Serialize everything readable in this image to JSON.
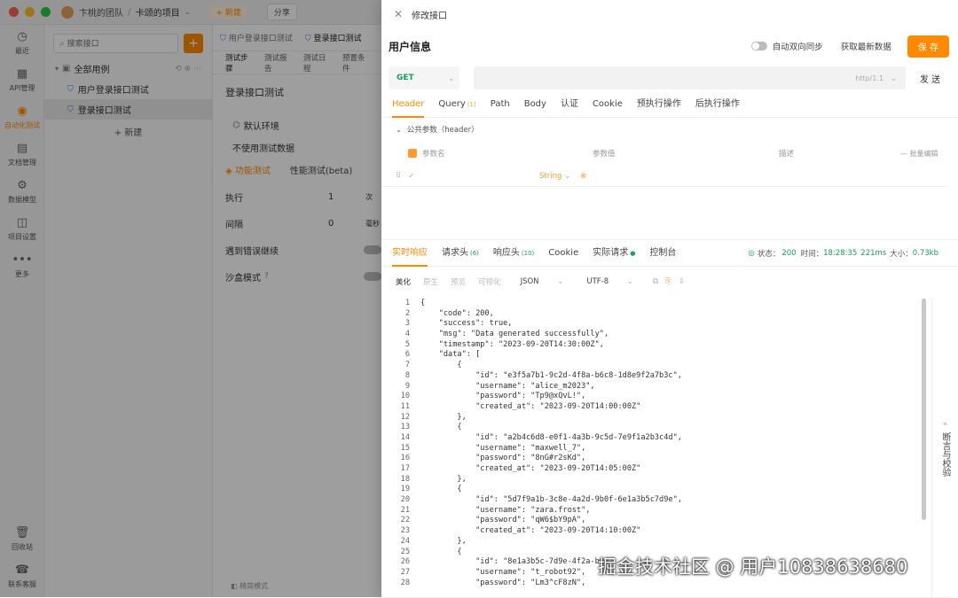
{
  "titlebar": {
    "team": "卞桃的团队",
    "project": "卡颂的项目",
    "new_btn": "+ 新建",
    "share_btn": "分享"
  },
  "leftnav": [
    {
      "label": "最近",
      "icon": "clock-icon",
      "glyph": "◷"
    },
    {
      "label": "API管理",
      "icon": "api-icon",
      "glyph": "▦"
    },
    {
      "label": "自动化测试",
      "icon": "automation-icon",
      "glyph": "◉"
    },
    {
      "label": "文档管理",
      "icon": "document-icon",
      "glyph": "▤"
    },
    {
      "label": "数据模型",
      "icon": "model-icon",
      "glyph": "⚙"
    },
    {
      "label": "项目设置",
      "icon": "settings-icon",
      "glyph": "◫"
    },
    {
      "label": "更多",
      "icon": "more-icon",
      "glyph": "•••"
    }
  ],
  "leftnav_bottom": [
    {
      "label": "回收站",
      "icon": "trash-icon",
      "glyph": "🗑"
    },
    {
      "label": "联系客服",
      "icon": "support-icon",
      "glyph": "☎"
    }
  ],
  "tree": {
    "search_placeholder": "搜索接口",
    "root": "全部用例",
    "items": [
      "用户登录接口测试",
      "登录接口测试"
    ],
    "new_label": "+ 新建"
  },
  "mid": {
    "tabs": [
      "用户登录接口测试",
      "登录接口测试"
    ],
    "subtabs": [
      "测试步骤",
      "测试报告",
      "测试日程",
      "预置条件"
    ],
    "title": "登录接口测试",
    "env": "默认环境",
    "test_data": "不使用测试数据",
    "mode_tabs": [
      "功能测试",
      "性能测试(beta)"
    ],
    "rows": [
      {
        "label": "执行",
        "value": "1",
        "unit": "次"
      },
      {
        "label": "间隔",
        "value": "0",
        "unit": "毫秒"
      }
    ],
    "toggles": [
      "遇到错误继续",
      "沙盒模式"
    ],
    "footer": "精简模式"
  },
  "drawer": {
    "title": "修改接口",
    "section": "用户信息",
    "sync_label": "自动双向同步",
    "fetch_label": "获取最新数据",
    "save_label": "保 存",
    "method": "GET",
    "protocol": "http/1.1",
    "send_label": "发 送",
    "req_tabs": [
      {
        "label": "Header",
        "badge": ""
      },
      {
        "label": "Query",
        "badge": "(1)"
      },
      {
        "label": "Path",
        "badge": ""
      },
      {
        "label": "Body",
        "badge": ""
      },
      {
        "label": "认证",
        "badge": ""
      },
      {
        "label": "Cookie",
        "badge": ""
      },
      {
        "label": "预执行操作",
        "badge": ""
      },
      {
        "label": "后执行操作",
        "badge": ""
      }
    ],
    "public_params": "公共参数（header）",
    "param_cols": [
      "参数名",
      "参数值",
      "描述"
    ],
    "bulk_edit": "批量编辑",
    "param_type": "String",
    "resp_tabs": [
      {
        "label": "实时响应",
        "badge": ""
      },
      {
        "label": "请求头",
        "badge": "(6)"
      },
      {
        "label": "响应头",
        "badge": "(10)"
      },
      {
        "label": "Cookie",
        "badge": ""
      },
      {
        "label": "实际请求",
        "badge": "●"
      },
      {
        "label": "控制台",
        "badge": ""
      }
    ],
    "status": {
      "label": "状态：",
      "code": "200",
      "time_label": "时间：",
      "time": "18:28:35",
      "duration": "221ms",
      "size_label": "大小：",
      "size": "0.73kb"
    },
    "toolbar": {
      "beautify": "美化",
      "raw": "原生",
      "preview": "预览",
      "visualize": "可视化",
      "format": "JSON",
      "encoding": "UTF-8"
    },
    "assert_label": "断言与校验",
    "watermark": "掘金技术社区 @ 用户10838638680",
    "code_lines": [
      "{",
      "    \"code\": 200,",
      "    \"success\": true,",
      "    \"msg\": \"Data generated successfully\",",
      "    \"timestamp\": \"2023-09-20T14:30:00Z\",",
      "    \"data\": [",
      "        {",
      "            \"id\": \"e3f5a7b1-9c2d-4f8a-b6c8-1d8e9f2a7b3c\",",
      "            \"username\": \"alice_m2023\",",
      "            \"password\": \"Tp9@xQvL!\",",
      "            \"created_at\": \"2023-09-20T14:00:00Z\"",
      "        },",
      "        {",
      "            \"id\": \"a2b4c6d8-e0f1-4a3b-9c5d-7e9f1a2b3c4d\",",
      "            \"username\": \"maxwell_7\",",
      "            \"password\": \"8nG#r2sKd\",",
      "            \"created_at\": \"2023-09-20T14:05:00Z\"",
      "        },",
      "        {",
      "            \"id\": \"5d7f9a1b-3c8e-4a2d-9b0f-6e1a3b5c7d9e\",",
      "            \"username\": \"zara.frost\",",
      "            \"password\": \"qW6$bY9pA\",",
      "            \"created_at\": \"2023-09-20T14:10:00Z\"",
      "        },",
      "        {",
      "            \"id\": \"8e1a3b5c-7d9e-4f2a-b6c",
      "            \"username\": \"t_robot92\",",
      "            \"password\": \"Lm3^cF8zN\","
    ]
  }
}
